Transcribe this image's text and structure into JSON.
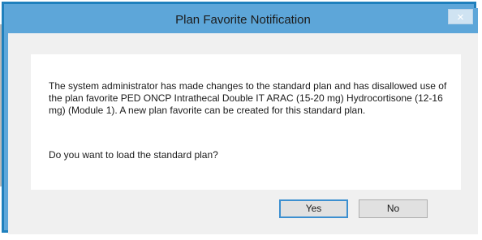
{
  "window": {
    "title": "Plan Favorite Notification",
    "close_symbol": "×"
  },
  "message": {
    "body": "The system administrator has made changes to the standard plan and has disallowed use of the plan favorite PED ONCP Intrathecal Double IT ARAC (15-20 mg) Hydrocortisone (12-16 mg) (Module 1). A new plan favorite can be created for this standard plan.",
    "question": "Do you want to load the standard plan?"
  },
  "buttons": {
    "yes_label": "Yes",
    "no_label": "No"
  },
  "colors": {
    "title_bar": "#5da6d9",
    "border": "#1f80bd",
    "dialog_bg": "#f0f0f0",
    "focus_border": "#3c8fd0"
  }
}
